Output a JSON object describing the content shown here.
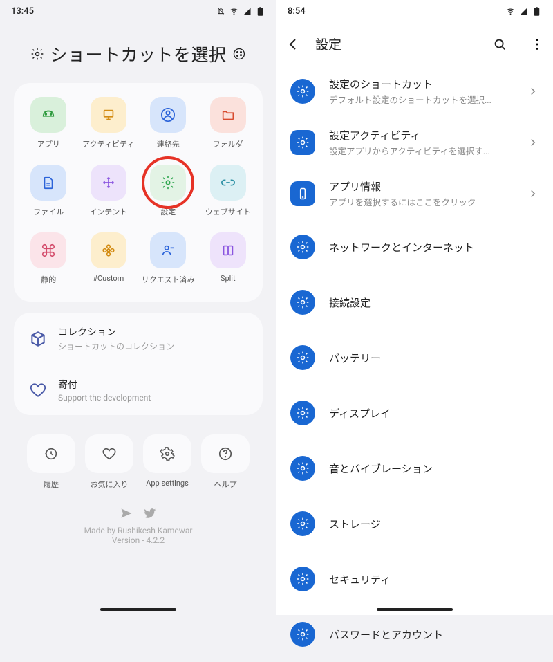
{
  "left": {
    "status_time": "13:45",
    "title": "ショートカットを選択",
    "grid": [
      {
        "label": "アプリ",
        "theme": "t-green",
        "icon": "android-icon"
      },
      {
        "label": "アクティビティ",
        "theme": "t-amber",
        "icon": "monitor-icon"
      },
      {
        "label": "連絡先",
        "theme": "t-blue",
        "icon": "contact-icon"
      },
      {
        "label": "フォルダ",
        "theme": "t-red",
        "icon": "folder-icon"
      },
      {
        "label": "ファイル",
        "theme": "t-blue",
        "icon": "file-icon"
      },
      {
        "label": "インテント",
        "theme": "t-lilac",
        "icon": "move-icon"
      },
      {
        "label": "設定",
        "theme": "t-greenlt",
        "icon": "gear-icon",
        "highlight": true
      },
      {
        "label": "ウェブサイト",
        "theme": "t-cyan",
        "icon": "link-icon"
      },
      {
        "label": "静的",
        "theme": "t-pink",
        "icon": "command-icon"
      },
      {
        "label": "#Custom",
        "theme": "t-amber",
        "icon": "flower-icon"
      },
      {
        "label": "リクエスト済み",
        "theme": "t-blue",
        "icon": "person-remove-icon"
      },
      {
        "label": "Split",
        "theme": "t-violet",
        "icon": "split-icon"
      }
    ],
    "list": [
      {
        "title": "コレクション",
        "sub": "ショートカットのコレクション",
        "icon": "package-icon"
      },
      {
        "title": "寄付",
        "sub": "Support the development",
        "icon": "heart-icon"
      }
    ],
    "actions": [
      {
        "label": "履歴",
        "icon": "history-icon"
      },
      {
        "label": "お気に入り",
        "icon": "heart-icon"
      },
      {
        "label": "App settings",
        "icon": "settings-alt-icon"
      },
      {
        "label": "ヘルプ",
        "icon": "help-icon"
      }
    ],
    "footer_credit": "Made by Rushikesh Kamewar",
    "footer_version": "Version - 4.2.2"
  },
  "right": {
    "status_time": "8:54",
    "header": "設定",
    "items": [
      {
        "title": "設定のショートカット",
        "sub": "デフォルト設定のショートカットを選択...",
        "badge": "round",
        "chevron": true
      },
      {
        "title": "設定アクティビティ",
        "sub": "設定アプリからアクティビティを選択す...",
        "badge": "square",
        "chevron": true
      },
      {
        "title": "アプリ情報",
        "sub": "アプリを選択するにはここをクリック",
        "badge": "square-alt",
        "chevron": true
      },
      {
        "title": "ネットワークとインターネット",
        "badge": "round"
      },
      {
        "title": "接続設定",
        "badge": "round"
      },
      {
        "title": "バッテリー",
        "badge": "round"
      },
      {
        "title": "ディスプレイ",
        "badge": "round"
      },
      {
        "title": "音とバイブレーション",
        "badge": "round"
      },
      {
        "title": "ストレージ",
        "badge": "round"
      },
      {
        "title": "セキュリティ",
        "badge": "round"
      },
      {
        "title": "パスワードとアカウント",
        "badge": "round"
      }
    ]
  }
}
